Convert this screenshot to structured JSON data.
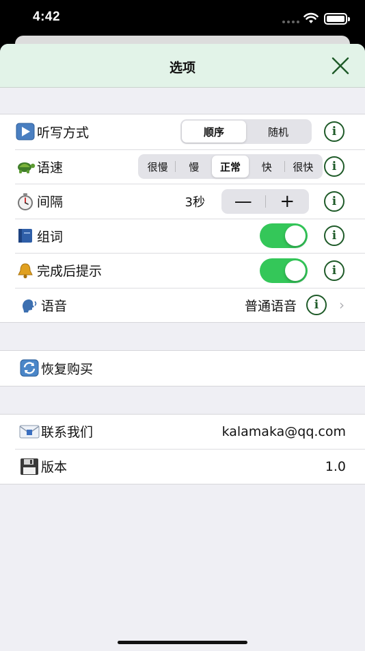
{
  "status_bar": {
    "time": "4:42"
  },
  "nav": {
    "title": "选项"
  },
  "settings": {
    "dictation_mode": {
      "label": "听写方式",
      "options": [
        "顺序",
        "随机"
      ],
      "selected": 0
    },
    "speed": {
      "label": "语速",
      "options": [
        "很慢",
        "慢",
        "正常",
        "快",
        "很快"
      ],
      "selected": 2
    },
    "interval": {
      "label": "间隔",
      "value": "3秒",
      "minus": "—",
      "plus": "+"
    },
    "word_group": {
      "label": "组词",
      "enabled": true
    },
    "finish_alert": {
      "label": "完成后提示",
      "enabled": true
    },
    "voice": {
      "label": "语音",
      "value": "普通语音"
    },
    "info_glyph": "i",
    "chevron": "›"
  },
  "purchase": {
    "restore_label": "恢复购买"
  },
  "about": {
    "contact_label": "联系我们",
    "contact_value": "kalamaka@qq.com",
    "version_label": "版本",
    "version_value": "1.0"
  },
  "colors": {
    "accent": "#34c759",
    "nav_bg": "#e2f3e8",
    "info": "#1e5a28"
  }
}
